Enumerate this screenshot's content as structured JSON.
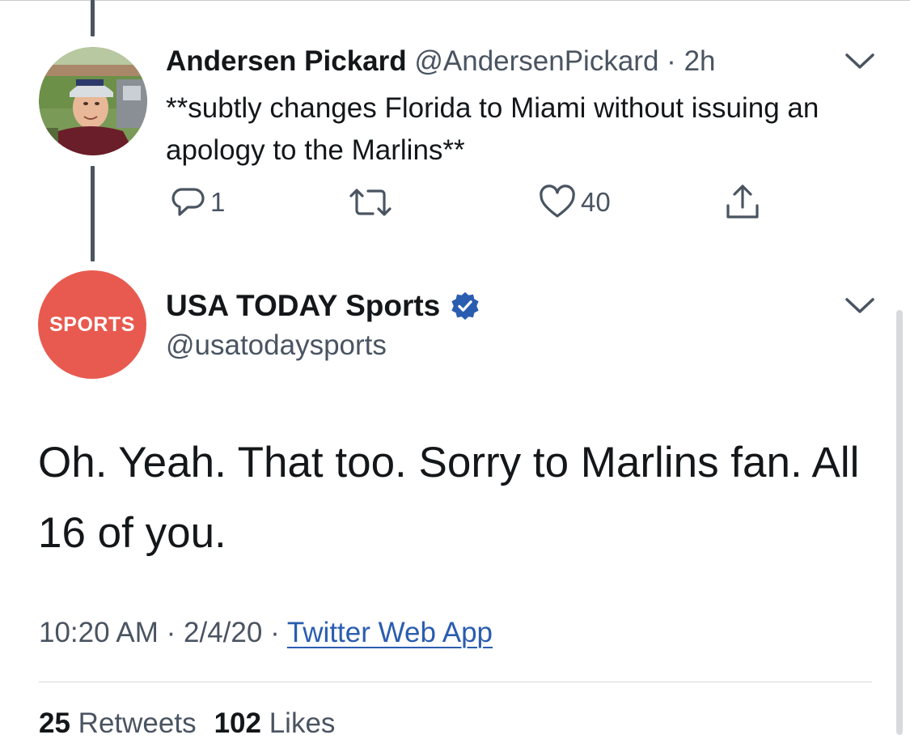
{
  "reply_tweet": {
    "name": "Andersen Pickard",
    "handle": "@AndersenPickard",
    "separator": "·",
    "time": "2h",
    "text": "**subtly changes Florida to Miami without issuing an apology to the Marlins**",
    "reply_count": "1",
    "like_count": "40",
    "avatar_icon": "profile-photo"
  },
  "main_tweet": {
    "name": "USA TODAY Sports",
    "handle": "@usatodaysports",
    "avatar_label": "SPORTS",
    "avatar_color": "#e85a4f",
    "verified_color": "#2a5db0",
    "text": "Oh. Yeah. That too. Sorry to Marlins fan. All 16 of you.",
    "time": "10:20 AM",
    "date": "2/4/20",
    "meta_separator": "·",
    "source": "Twitter Web App",
    "retweets_count": "25",
    "retweets_label": "Retweets",
    "likes_count": "102",
    "likes_label": "Likes"
  },
  "colors": {
    "text_primary": "#14171a",
    "text_secondary": "#4a5461",
    "link": "#2a5db0",
    "thread_line": "#4a5560"
  }
}
